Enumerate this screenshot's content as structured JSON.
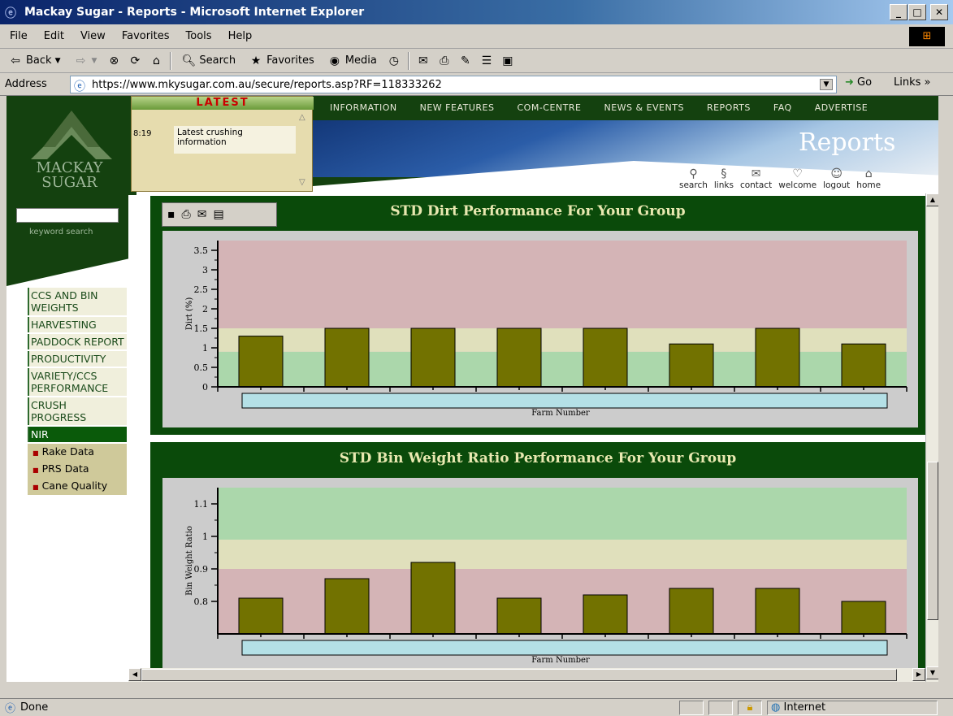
{
  "window": {
    "title": "Mackay Sugar - Reports - Microsoft Internet Explorer"
  },
  "menubar": {
    "items": [
      "File",
      "Edit",
      "View",
      "Favorites",
      "Tools",
      "Help"
    ]
  },
  "toolbar": {
    "back": "Back",
    "search": "Search",
    "favorites": "Favorites",
    "media": "Media"
  },
  "address": {
    "label": "Address",
    "url": "https://www.mkysugar.com.au/secure/reports.asp?RF=118333262",
    "go": "Go",
    "links": "Links »"
  },
  "header": {
    "nav": [
      "INFORMATION",
      "NEW FEATURES",
      "COM-CENTRE",
      "NEWS & EVENTS",
      "REPORTS",
      "FAQ",
      "ADVERTISE"
    ],
    "page_title": "Reports",
    "logo_line1": "MACKAY",
    "logo_line2": "SUGAR",
    "latest": {
      "title": "LATEST",
      "time": "8:19",
      "text": "Latest crushing information"
    },
    "icons": [
      {
        "label": "search",
        "icon": "search-icon"
      },
      {
        "label": "links",
        "icon": "links-icon"
      },
      {
        "label": "contact",
        "icon": "envelope-icon"
      },
      {
        "label": "welcome",
        "icon": "heart-icon"
      },
      {
        "label": "logout",
        "icon": "logout-icon"
      },
      {
        "label": "home",
        "icon": "home-icon"
      }
    ]
  },
  "sidebar": {
    "keyword_label": "keyword search",
    "menu": [
      "CCS AND BIN WEIGHTS",
      "HARVESTING",
      "PADDOCK REPORT",
      "PRODUCTIVITY",
      "VARIETY/CCS PERFORMANCE",
      "CRUSH PROGRESS",
      "NIR"
    ],
    "active": "NIR",
    "submenu": [
      "Rake Data",
      "PRS Data",
      "Cane Quality"
    ]
  },
  "colors": {
    "band_red": "#d4b4b6",
    "band_yellow": "#e0e0bc",
    "band_green": "#abd7ab",
    "bar": "#727200",
    "panel": "#0a4a0a",
    "xbox": "#b4e0e6"
  },
  "chart_data": [
    {
      "type": "bar",
      "title": "STD Dirt Performance For Your Group",
      "xlabel": "Farm Number",
      "ylabel": "Dirt (%)",
      "ylim": [
        0,
        3.75
      ],
      "yticks": [
        "0",
        "0.5",
        "1",
        "1.5",
        "2",
        "2.5",
        "3",
        "3.5"
      ],
      "categories": [
        "",
        "",
        "",
        "",
        "",
        "",
        "",
        ""
      ],
      "values": [
        1.3,
        1.5,
        1.5,
        1.5,
        1.5,
        1.1,
        1.5,
        1.1
      ],
      "bands": [
        {
          "from": 0,
          "to": 0.9,
          "color": "green"
        },
        {
          "from": 0.9,
          "to": 1.5,
          "color": "yellow"
        },
        {
          "from": 1.5,
          "to": 3.75,
          "color": "red"
        }
      ],
      "grid": false
    },
    {
      "type": "bar",
      "title": "STD Bin Weight Ratio Performance For Your Group",
      "xlabel": "Farm Number",
      "ylabel": "Bin Weight Ratio",
      "ylim": [
        0.7,
        1.15
      ],
      "yticks": [
        "0.8",
        "0.9",
        "1",
        "1.1"
      ],
      "categories": [
        "",
        "",
        "",
        "",
        "",
        "",
        "",
        ""
      ],
      "values": [
        0.81,
        0.87,
        0.92,
        0.81,
        0.82,
        0.84,
        0.84,
        0.8
      ],
      "bands": [
        {
          "from": 0.7,
          "to": 0.9,
          "color": "red"
        },
        {
          "from": 0.9,
          "to": 0.99,
          "color": "yellow"
        },
        {
          "from": 0.99,
          "to": 1.15,
          "color": "green"
        }
      ],
      "grid": false
    }
  ],
  "status": {
    "text": "Done",
    "zone": "Internet"
  }
}
